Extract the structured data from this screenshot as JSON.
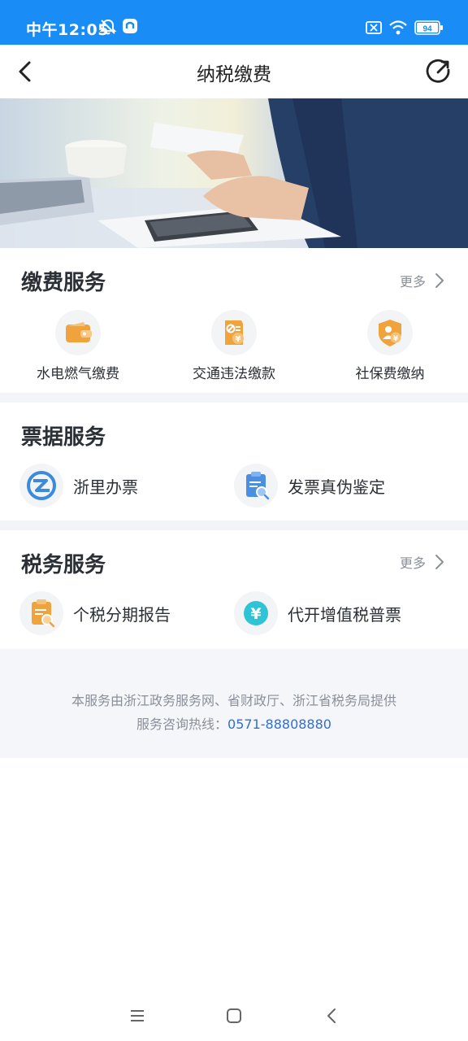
{
  "status_bar": {
    "time": "中午12:05",
    "battery": "94"
  },
  "nav": {
    "title": "纳税缴费"
  },
  "fee_services": {
    "title": "缴费服务",
    "more": "更多",
    "items": [
      {
        "label": "水电燃气缴费",
        "icon": "wallet-icon"
      },
      {
        "label": "交通违法缴款",
        "icon": "traffic-fine-icon"
      },
      {
        "label": "社保费缴纳",
        "icon": "social-security-icon"
      }
    ]
  },
  "invoice_services": {
    "title": "票据服务",
    "items": [
      {
        "label": "浙里办票",
        "icon": "zheli-logo-icon"
      },
      {
        "label": "发票真伪鉴定",
        "icon": "invoice-check-icon"
      }
    ]
  },
  "tax_services": {
    "title": "税务服务",
    "more": "更多",
    "items": [
      {
        "label": "个税分期报告",
        "icon": "tax-report-icon"
      },
      {
        "label": "代开增值税普票",
        "icon": "yuan-icon"
      }
    ]
  },
  "footer": {
    "provider": "本服务由浙江政务服务网、省财政厅、浙江省税务局提供",
    "hotline_label": "服务咨询热线：",
    "hotline": "0571-88808880"
  },
  "colors": {
    "status_bar": "#1a8cf5",
    "accent_orange": "#f0a23c",
    "accent_blue": "#2f6fd6",
    "teal": "#2ec4d6"
  }
}
